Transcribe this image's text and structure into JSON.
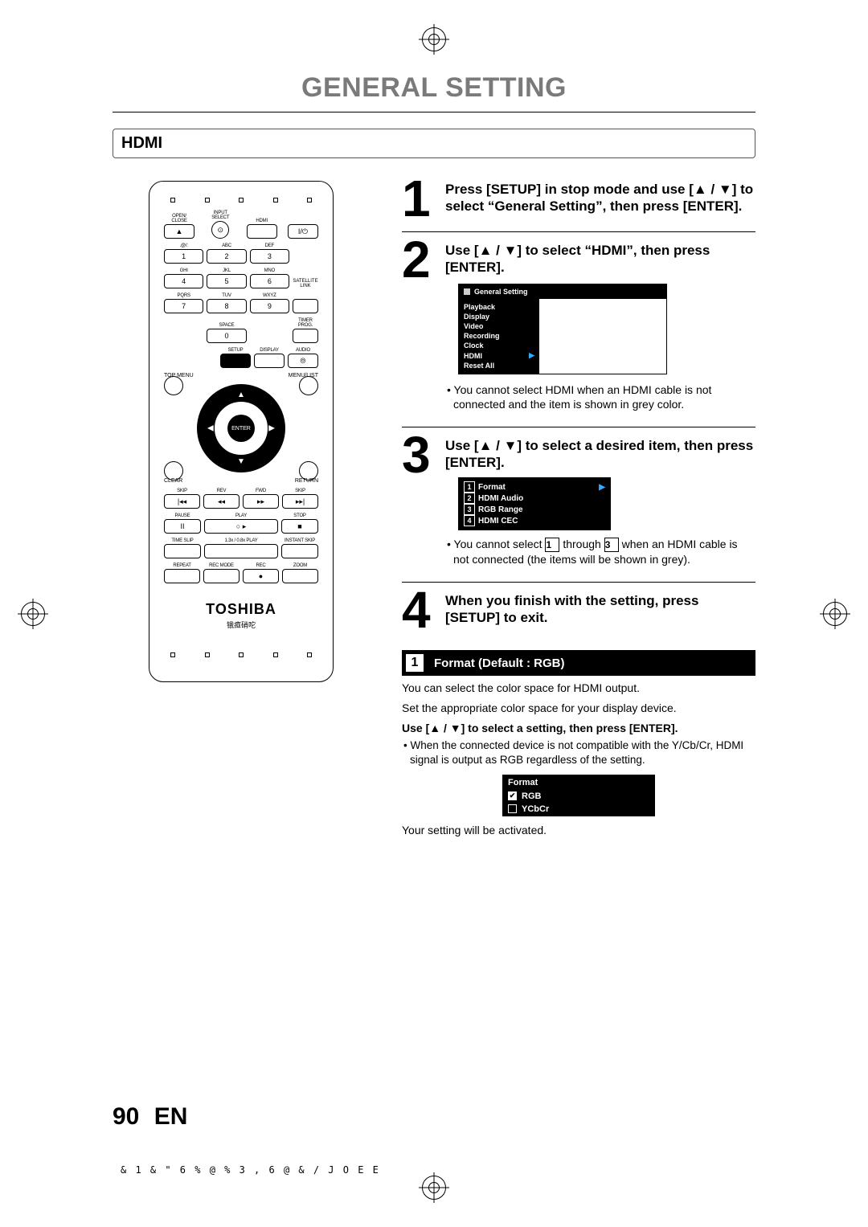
{
  "page": {
    "title": "GENERAL SETTING",
    "section": "HDMI",
    "page_number": "90",
    "lang": "EN",
    "print_code": "& 1 & \" 6 % @ % 3    , 6 @ & /   J O E E"
  },
  "remote": {
    "brand": "TOSHIBA",
    "sub": "锇痖硝咜",
    "row1": [
      {
        "lbl": "OPEN/\nCLOSE",
        "key": "▲"
      },
      {
        "lbl": "INPUT\nSELECT",
        "key": "⊙"
      },
      {
        "lbl": "HDMI",
        "key": " "
      },
      {
        "lbl": "",
        "key": "I/⏻"
      }
    ],
    "numpad": [
      {
        "lbl": ".@/:",
        "key": "1"
      },
      {
        "lbl": "ABC",
        "key": "2"
      },
      {
        "lbl": "DEF",
        "key": "3"
      },
      {
        "lbl": "GHI",
        "key": "4"
      },
      {
        "lbl": "JKL",
        "key": "5"
      },
      {
        "lbl": "MNO",
        "key": "6"
      },
      {
        "lbl": "PQRS",
        "key": "7"
      },
      {
        "lbl": "TUV",
        "key": "8"
      },
      {
        "lbl": "WXYZ",
        "key": "9"
      },
      {
        "lbl": "",
        "key": ""
      },
      {
        "lbl": "SPACE",
        "key": "0"
      },
      {
        "lbl": "",
        "key": ""
      }
    ],
    "side_upper": "SATELLITE\nLINK",
    "side_lower": "TIMER\nPROG.",
    "row_setup": [
      {
        "lbl": "SETUP",
        "key": " "
      },
      {
        "lbl": "DISPLAY",
        "key": " "
      },
      {
        "lbl": "AUDIO",
        "key": "⦾"
      }
    ],
    "dpad": {
      "top_menu": "TOP MENU",
      "menu_list": "MENU/LIST",
      "clear": "CLEAR",
      "return": "RETURN",
      "enter": "ENTER"
    },
    "transport1": [
      {
        "lbl": "SKIP",
        "key": "|◂◂"
      },
      {
        "lbl": "REV",
        "key": "◂◂"
      },
      {
        "lbl": "FWD",
        "key": "▸▸"
      },
      {
        "lbl": "SKIP",
        "key": "▸▸|"
      }
    ],
    "transport2": [
      {
        "lbl": "PAUSE",
        "key": "II"
      },
      {
        "lbl": "PLAY",
        "key": "○ ▸"
      },
      {
        "lbl": "STOP",
        "key": "■"
      }
    ],
    "transport3": [
      {
        "lbl": "TIME SLIP",
        "key": " "
      },
      {
        "lbl": "1.3x / 0.8x PLAY",
        "key": " "
      },
      {
        "lbl": "INSTANT SKIP",
        "key": " "
      }
    ],
    "transport4": [
      {
        "lbl": "REPEAT",
        "key": " "
      },
      {
        "lbl": "REC MODE",
        "key": " "
      },
      {
        "lbl": "REC",
        "key": "●"
      },
      {
        "lbl": "ZOOM",
        "key": " "
      }
    ]
  },
  "steps": {
    "s1": "Press [SETUP] in stop mode and use [▲ / ▼] to select “General Setting”, then press [ENTER].",
    "s2": "Use [▲ / ▼] to select “HDMI”, then press [ENTER].",
    "s2_osd_title": "General Setting",
    "s2_osd_items": [
      "Playback",
      "Display",
      "Video",
      "Recording",
      "Clock",
      "HDMI",
      "Reset All"
    ],
    "s2_note": "You cannot select HDMI when an HDMI cable is not connected and the item is shown in grey color.",
    "s3": "Use [▲ / ▼] to select a desired item, then press [ENTER].",
    "s3_items": [
      "Format",
      "HDMI Audio",
      "RGB Range",
      "HDMI CEC"
    ],
    "s3_note_a": "You cannot select ",
    "s3_note_b": " through ",
    "s3_note_c": " when an HDMI cable is not connected (the items will be shown in grey).",
    "s3_box_a": "1",
    "s3_box_b": "3",
    "s4": "When you finish with the setting, press [SETUP] to exit."
  },
  "detail": {
    "num": "1",
    "title": "Format (Default : RGB)",
    "p1": "You can select the color space for HDMI output.",
    "p2": "Set the appropriate color space for your display device.",
    "p3": "Use [▲ / ▼] to select a setting, then press [ENTER].",
    "bullet": "When the connected device is not compatible with the Y/Cb/Cr, HDMI signal is output as RGB regardless of the setting.",
    "box_title": "Format",
    "opt1": "RGB",
    "opt2": "YCbCr",
    "closing": "Your setting will be activated."
  }
}
